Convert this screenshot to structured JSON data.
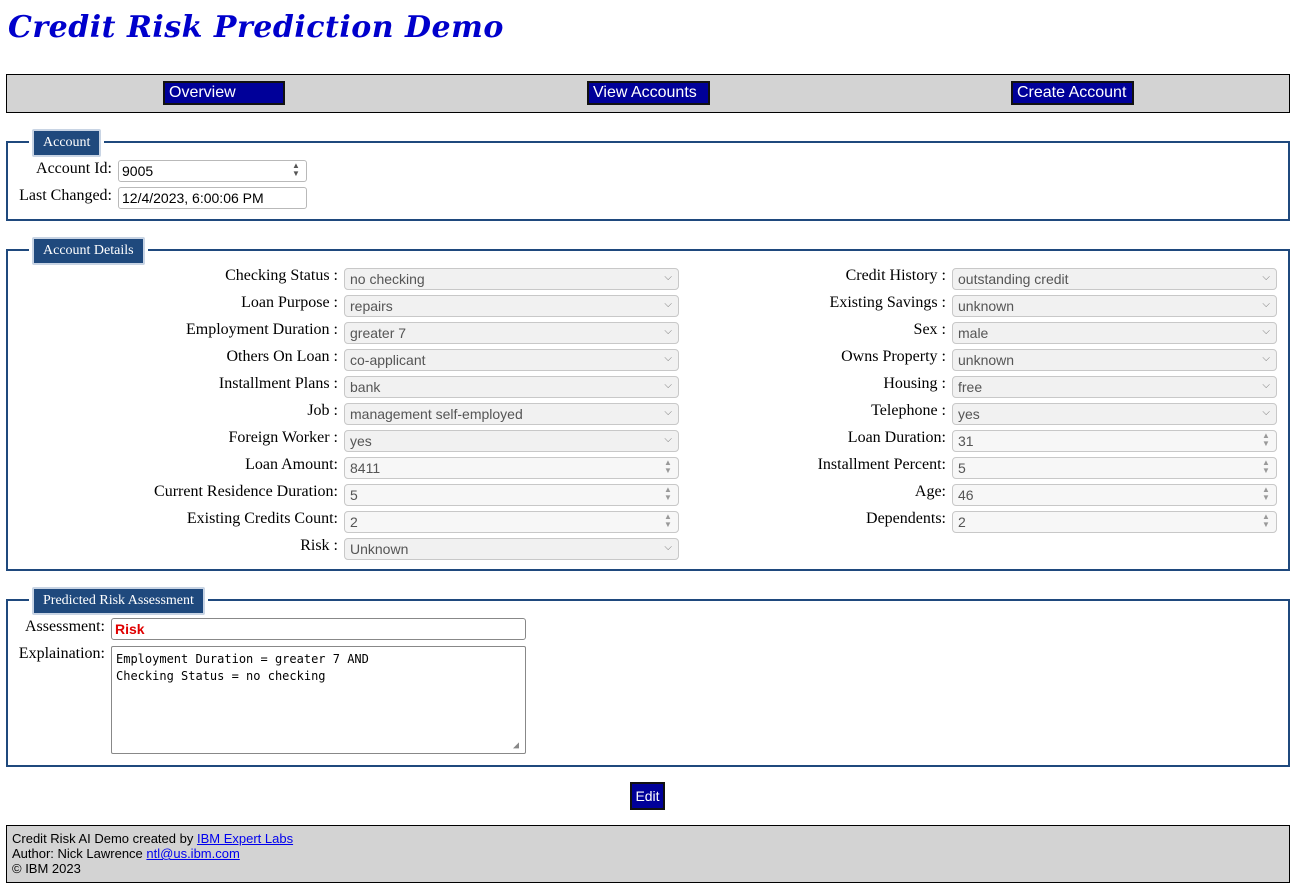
{
  "app": {
    "title": "Credit Risk Prediction Demo"
  },
  "nav": {
    "overview": "Overview",
    "view_accounts": "View Accounts",
    "create_account": "Create Account"
  },
  "account": {
    "legend": "Account",
    "id_label": "Account Id:",
    "id_value": "9005",
    "changed_label": "Last Changed:",
    "changed_value": "12/4/2023, 6:00:06 PM"
  },
  "details": {
    "legend": "Account Details",
    "left": [
      {
        "label": "Checking Status :",
        "value": "no checking",
        "kind": "select"
      },
      {
        "label": "Loan Purpose :",
        "value": "repairs",
        "kind": "select"
      },
      {
        "label": "Employment Duration :",
        "value": "greater 7",
        "kind": "select"
      },
      {
        "label": "Others On Loan :",
        "value": "co-applicant",
        "kind": "select"
      },
      {
        "label": "Installment Plans :",
        "value": "bank",
        "kind": "select"
      },
      {
        "label": "Job :",
        "value": "management self-employed",
        "kind": "select"
      },
      {
        "label": "Foreign Worker :",
        "value": "yes",
        "kind": "select"
      },
      {
        "label": "Loan Amount:",
        "value": "8411",
        "kind": "number"
      },
      {
        "label": "Current Residence Duration:",
        "value": "5",
        "kind": "number"
      },
      {
        "label": "Existing Credits Count:",
        "value": "2",
        "kind": "number"
      },
      {
        "label": "Risk :",
        "value": "Unknown",
        "kind": "select"
      }
    ],
    "right": [
      {
        "label": "Credit History :",
        "value": "outstanding credit",
        "kind": "select"
      },
      {
        "label": "Existing Savings :",
        "value": "unknown",
        "kind": "select"
      },
      {
        "label": "Sex :",
        "value": "male",
        "kind": "select"
      },
      {
        "label": "Owns Property :",
        "value": "unknown",
        "kind": "select"
      },
      {
        "label": "Housing :",
        "value": "free",
        "kind": "select"
      },
      {
        "label": "Telephone :",
        "value": "yes",
        "kind": "select"
      },
      {
        "label": "Loan Duration:",
        "value": "31",
        "kind": "number"
      },
      {
        "label": "Installment Percent:",
        "value": "5",
        "kind": "number"
      },
      {
        "label": "Age:",
        "value": "46",
        "kind": "number"
      },
      {
        "label": "Dependents:",
        "value": "2",
        "kind": "number"
      }
    ]
  },
  "prediction": {
    "legend": "Predicted Risk Assessment",
    "assessment_label": "Assessment:",
    "assessment_value": "Risk",
    "assessment_color": "#e00000",
    "explanation_label": "Explaination:",
    "explanation_value": "Employment Duration = greater 7 AND\nChecking Status = no checking"
  },
  "edit_label": "Edit",
  "footer": {
    "line1_text": "Credit Risk AI Demo created by ",
    "line1_link": "IBM Expert Labs",
    "line2_text": "Author: Nick Lawrence ",
    "line2_link": "ntl@us.ibm.com",
    "line3_text": "© IBM 2023"
  },
  "colors": {
    "nav_button": "#000099",
    "fieldset_border": "#1f497d",
    "title": "#0000cc",
    "bar_bg": "#d3d3d3"
  },
  "icons": {
    "select": "chevron-down-icon",
    "number": "spinner-icon",
    "textarea": "resize-grip-icon"
  }
}
